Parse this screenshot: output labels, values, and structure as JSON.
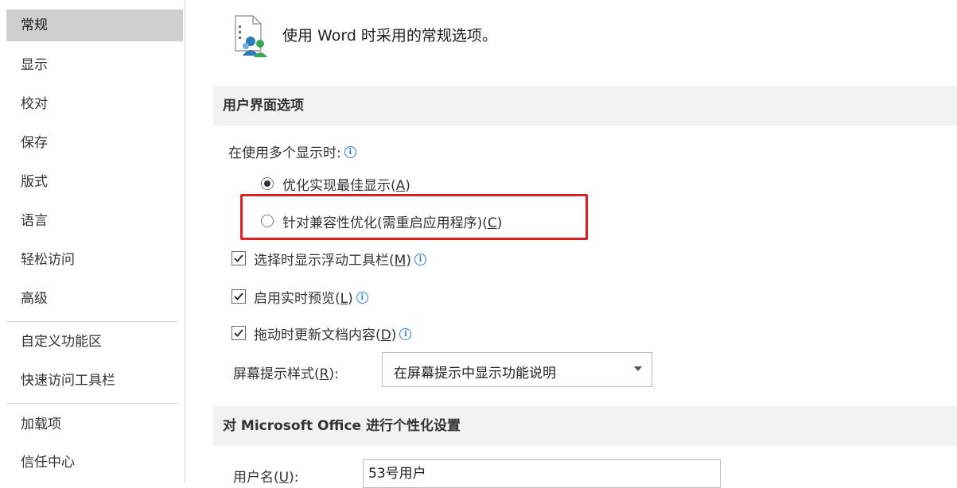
{
  "sidebar": {
    "items": [
      {
        "label": "常规"
      },
      {
        "label": "显示"
      },
      {
        "label": "校对"
      },
      {
        "label": "保存"
      },
      {
        "label": "版式"
      },
      {
        "label": "语言"
      },
      {
        "label": "轻松访问"
      },
      {
        "label": "高级"
      },
      {
        "label": "自定义功能区"
      },
      {
        "label": "快速访问工具栏"
      },
      {
        "label": "加载项"
      },
      {
        "label": "信任中心"
      }
    ]
  },
  "header": {
    "text": "使用 Word 时采用的常规选项。"
  },
  "ui_options": {
    "section_title": "用户界面选项",
    "multi_display_label": "在使用多个显示时:",
    "radio_optimize": {
      "text": "优化实现最佳显示(",
      "key": "A",
      "end": ")"
    },
    "radio_compat": {
      "text": "针对兼容性优化(需重启应用程序)(",
      "key": "C",
      "end": ")"
    },
    "check_minitoolbar": {
      "text": "选择时显示浮动工具栏(",
      "key": "M",
      "end": ")"
    },
    "check_livepreview": {
      "text": "启用实时预览(",
      "key": "L",
      "end": ")"
    },
    "check_update": {
      "text": "拖动时更新文档内容(",
      "key": "D",
      "end": ")"
    },
    "screentip_label": {
      "text": "屏幕提示样式(",
      "key": "R",
      "end": "):"
    },
    "screentip_value": "在屏幕提示中显示功能说明"
  },
  "personalize": {
    "section_title": "对 Microsoft Office 进行个性化设置",
    "username_label": {
      "text": "用户名(",
      "key": "U",
      "end": "):"
    },
    "username_value": "53号用户"
  },
  "info_glyph": "i",
  "colors": {
    "highlight": "#e02020",
    "info": "#2f7ed8",
    "selected_nav": "#cfcfcf"
  }
}
